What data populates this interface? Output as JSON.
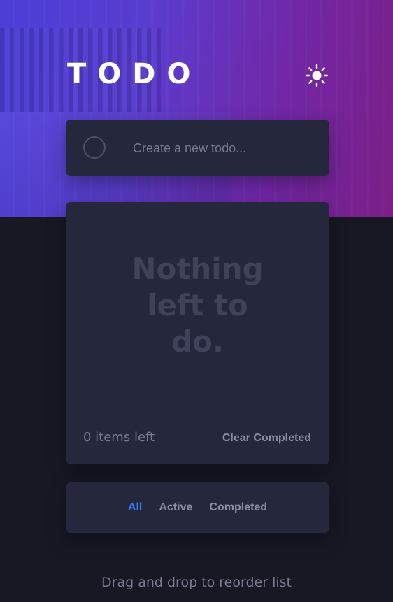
{
  "header": {
    "title": "TODO",
    "theme_icon": "sun-icon"
  },
  "create": {
    "placeholder": "Create a new todo...",
    "value": "",
    "check_icon": "empty-circle-icon"
  },
  "list": {
    "empty_message": "Nothing left to do.",
    "items_left": "0 items left",
    "clear_label": "Clear Completed"
  },
  "filters": {
    "items": [
      {
        "label": "All",
        "active": true
      },
      {
        "label": "Active",
        "active": false
      },
      {
        "label": "Completed",
        "active": false
      }
    ]
  },
  "footer": {
    "hint": "Drag and drop to reorder list"
  },
  "colors": {
    "background": "#181824",
    "card": "#25273c",
    "active_filter": "#3a7bfd",
    "muted_text": "#777a92",
    "gradient_start": "#4b3fd6",
    "gradient_end": "#7b1f86"
  }
}
